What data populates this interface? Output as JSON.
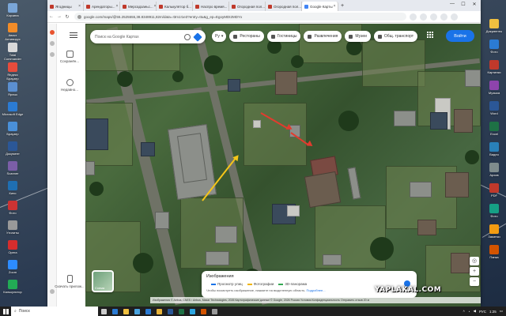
{
  "desktop": {
    "icons_left": [
      {
        "label": "Корзина",
        "color": "#7aa6d8"
      },
      {
        "label": "Аваст Антивирус",
        "color": "#f28c28"
      },
      {
        "label": "Total Commander",
        "color": "#d9d9d9"
      },
      {
        "label": "Яндекс Браузер",
        "color": "#e74c3c"
      },
      {
        "label": "Ярлык",
        "color": "#5b8fd0"
      },
      {
        "label": "Microsoft Edge",
        "color": "#2b7bd3"
      },
      {
        "label": "Браузер",
        "color": "#4a90d9"
      },
      {
        "label": "Документ",
        "color": "#2b5797"
      },
      {
        "label": "Scanner",
        "color": "#7b5ea7"
      },
      {
        "label": "Кино",
        "color": "#1f6fb2"
      },
      {
        "label": "Фото",
        "color": "#cc3333"
      },
      {
        "label": "Утилиты",
        "color": "#999999"
      },
      {
        "label": "Opera",
        "color": "#d62d2d"
      },
      {
        "label": "Zoom",
        "color": "#2d8cff"
      },
      {
        "label": "Калькулятор",
        "color": "#22aa55"
      }
    ],
    "icons_right": [
      {
        "label": "Документы",
        "color": "#f0c040"
      },
      {
        "label": "Фото",
        "color": "#2b7bd3"
      },
      {
        "label": "Картинки",
        "color": "#c0392b"
      },
      {
        "label": "Музыка",
        "color": "#8e44ad"
      },
      {
        "label": "Word",
        "color": "#2b5797"
      },
      {
        "label": "Excel",
        "color": "#1e7145"
      },
      {
        "label": "Видео",
        "color": "#2980b9"
      },
      {
        "label": "Архив",
        "color": "#7f8c8d"
      },
      {
        "label": "PDF",
        "color": "#c0392b"
      },
      {
        "label": "Фото",
        "color": "#16a085"
      },
      {
        "label": "Заметки",
        "color": "#f39c12"
      },
      {
        "label": "Папка",
        "color": "#d35400"
      }
    ]
  },
  "browser": {
    "tabs": [
      {
        "label": "Ягодницы",
        "active": false
      },
      {
        "label": "Арендаторы...",
        "active": false
      },
      {
        "label": "Мерсадзаеьс...",
        "active": false
      },
      {
        "label": "Калькулятор б...",
        "active": false
      },
      {
        "label": "Наспро время...",
        "active": false
      },
      {
        "label": "Огородная пол...",
        "active": false
      },
      {
        "label": "Огородная пол...",
        "active": false
      },
      {
        "label": "Google Карты",
        "active": true
      }
    ],
    "new_tab": "+",
    "window_controls": {
      "minimize": "—",
      "maximize": "☐",
      "close": "✕"
    },
    "url": "google.com/maps/@55.2525555,38.8348911,82m/data=!3m1!1e3?entry=ttu&g_ep=EgoyMDI2MDYx"
  },
  "maps": {
    "rail": {
      "menu_label": "Меню",
      "saved": "Сохранён...",
      "recent": "Недавно...",
      "download": "Скачать прилож..."
    },
    "search": {
      "placeholder": "Поиск на Google Картах"
    },
    "language_select": "Ру",
    "chips": [
      {
        "label": "Рестораны"
      },
      {
        "label": "Гостиницы"
      },
      {
        "label": "Развлечения"
      },
      {
        "label": "Музеи"
      },
      {
        "label": "Общ. транспорт"
      }
    ],
    "signin": "Войти",
    "layers_label": "Схема",
    "imagery": {
      "title": "Изображения",
      "legend": [
        {
          "label": "Просмотр улиц",
          "color": "#1a73e8"
        },
        {
          "label": "Фотографии",
          "color": "#f0b400"
        },
        {
          "label": "3D-панорама",
          "color": "#34a853"
        }
      ],
      "note": "Чтобы посмотреть изображение, нажмите на выделенную область.",
      "note_link": "Подробнее..."
    },
    "zoom": {
      "in": "+",
      "out": "−"
    },
    "attribution": "Изображения © Airbus, CNES / Airbus, Maxar Technologies, 2026 Картографические данные © Google, 2026   Россия   Условия   Конфиденциальность   Отправить отзыв   20 м"
  },
  "watermark": "YAPLAKAL.COM",
  "taskbar": {
    "search_placeholder": "Поиск",
    "apps": [
      {
        "name": "task-view",
        "color": "#cccccc"
      },
      {
        "name": "edge",
        "color": "#2b7bd3"
      },
      {
        "name": "explorer",
        "color": "#f0c040"
      },
      {
        "name": "store",
        "color": "#4aa3df"
      },
      {
        "name": "mail",
        "color": "#2b7bd3"
      },
      {
        "name": "chrome",
        "color": "#e8b33a"
      },
      {
        "name": "word",
        "color": "#2b5797"
      },
      {
        "name": "excel",
        "color": "#1e7145"
      },
      {
        "name": "telegram",
        "color": "#2ca5e0"
      },
      {
        "name": "photos",
        "color": "#d35400"
      },
      {
        "name": "app",
        "color": "#999999"
      }
    ],
    "tray": {
      "lang": "РУС",
      "time": "1:25"
    }
  }
}
